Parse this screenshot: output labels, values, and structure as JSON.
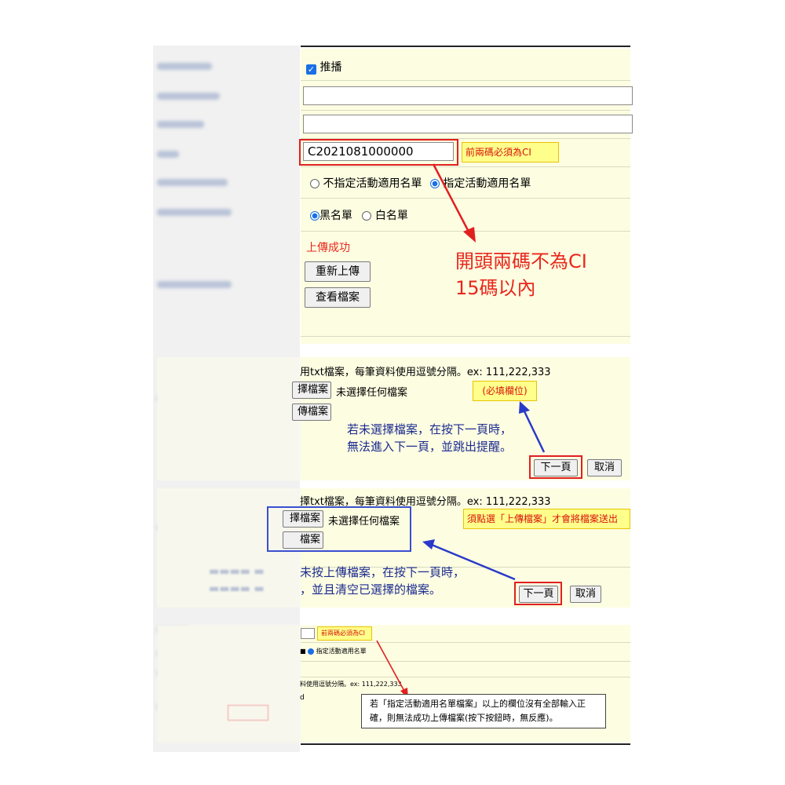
{
  "section1": {
    "broadcast_label": "推播",
    "broadcast_checked": true,
    "code_value": "C2021081000000",
    "code_tip": "前兩碼必須為CI",
    "radio_unspecified": "不指定活動適用名單",
    "radio_specified": "指定活動適用名單",
    "radio_blacklist": "黑名單",
    "radio_whitelist": "白名單",
    "upload_success": "上傳成功",
    "reupload_button": "重新上傳",
    "view_file_button": "查看檔案",
    "annotation_line1": "開頭兩碼不為CI",
    "annotation_line2": "15碼以內"
  },
  "section2": {
    "hint": "用txt檔案，每筆資料使用逗號分隔。ex: 111,222,333",
    "choose_file_button": "擇檔案",
    "no_file_text": "未選擇任何檔案",
    "required_badge": "(必填欄位)",
    "upload_button": "傳檔案",
    "annotation_line1": "若未選擇檔案，在按下一頁時，",
    "annotation_line2": "無法進入下一頁，並跳出提醒。",
    "next_button": "下一頁",
    "cancel_button": "取消"
  },
  "section3": {
    "hint": "擇txt檔案，每筆資料使用逗號分隔。ex: 111,222,333",
    "choose_file_button": "擇檔案",
    "no_file_text": "未選擇任何檔案",
    "upload_tip": "須點選「上傳檔案」才會將檔案送出",
    "upload_button": "檔案",
    "annotation_line1": "未按上傳檔案，在按下一頁時，",
    "annotation_line2": "，並且清空已選擇的檔案。",
    "next_button": "下一頁",
    "cancel_button": "取消"
  },
  "section4": {
    "code_tip": "前兩碼必須為CI",
    "radio_label": "指定活動適用名單",
    "hint": "料使用逗號分隔。ex: 111,222,333",
    "note_line1": "若「指定活動適用名單檔案」以上的欄位沒有全部輸入正",
    "note_line2": "確，則無法成功上傳檔案(按下按鈕時，無反應)。"
  },
  "colors": {
    "panel_bg": "#fdfde2",
    "annotation_red": "#e8281c",
    "annotation_blue": "#1c2b8f",
    "tip_yellow": "#ffff8c",
    "radio_blue": "#1a6fe6"
  }
}
